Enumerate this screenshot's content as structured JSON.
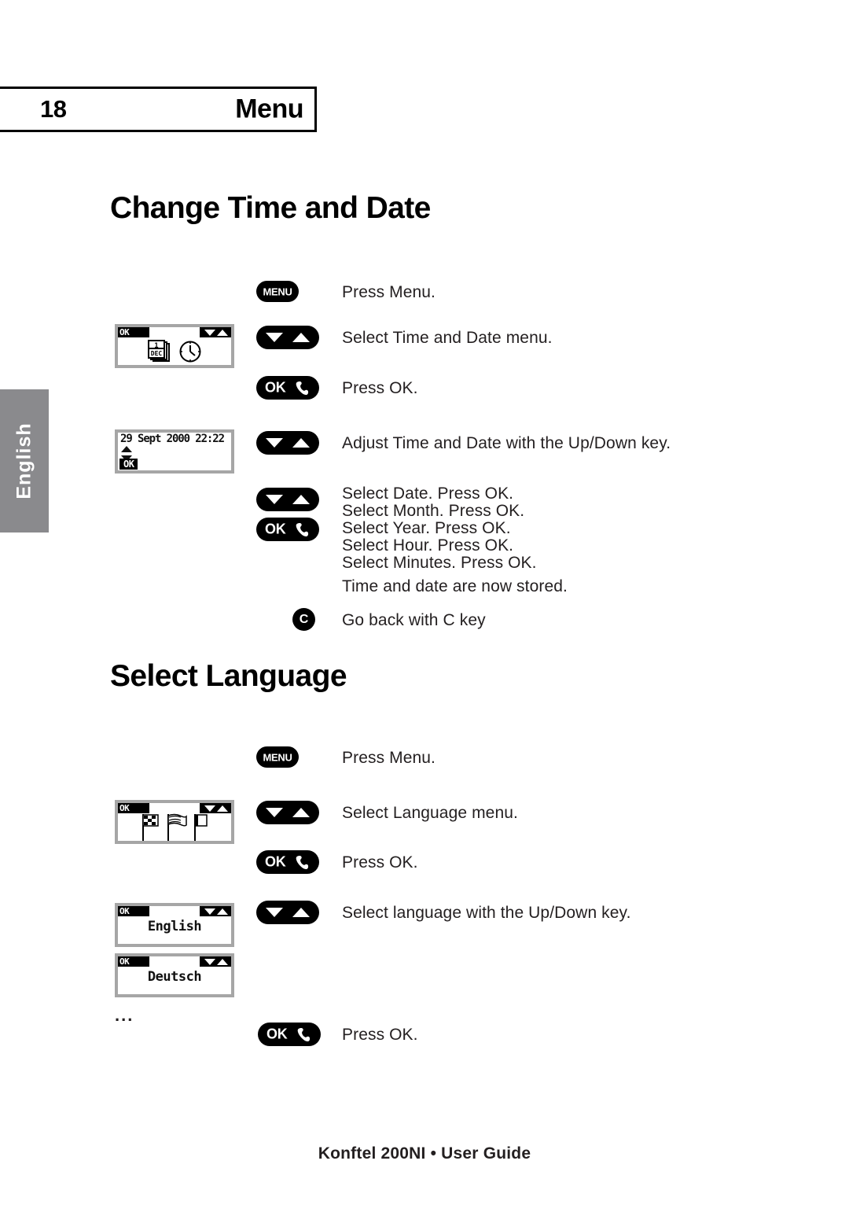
{
  "header": {
    "page_number": "18",
    "title": "Menu"
  },
  "side_tab": {
    "label": "English"
  },
  "sections": [
    {
      "heading": "Change Time and Date",
      "steps": [
        {
          "key": "menu-key",
          "key_label": "MENU",
          "text": "Press Menu."
        },
        {
          "key": "updown-key",
          "text": "Select Time and Date menu."
        },
        {
          "key": "ok-key",
          "key_label": "OK",
          "text": "Press OK."
        },
        {
          "key": "updown-key",
          "text": "Adjust Time and Date with the Up/Down key."
        },
        {
          "key": "updown-ok-key",
          "key_label": "OK",
          "text": "Select Date. Press OK.\nSelect Month. Press OK.\nSelect Year. Press OK.\nSelect Hour. Press OK.\nSelect Minutes. Press OK."
        },
        {
          "key": "none",
          "text": "Time and date are now stored."
        },
        {
          "key": "c-key",
          "key_label": "C",
          "text": "Go back with C key"
        }
      ]
    },
    {
      "heading": "Select Language",
      "steps": [
        {
          "key": "menu-key",
          "key_label": "MENU",
          "text": "Press Menu."
        },
        {
          "key": "updown-key",
          "text": "Select Language menu."
        },
        {
          "key": "ok-key",
          "key_label": "OK",
          "text": "Press OK."
        },
        {
          "key": "updown-key",
          "text": "Select language with the Up/Down key."
        },
        {
          "key": "ok-key",
          "key_label": "OK",
          "text": "Press OK."
        }
      ]
    }
  ],
  "displays": {
    "time_date_menu": {
      "status_ok": "OK",
      "icons": "calendar-clock-icons",
      "calendar_day": "1",
      "calendar_month": "DEC"
    },
    "time_date_edit": {
      "value": "29 Sept 2000 22:22",
      "status_ok": "OK"
    },
    "language_menu": {
      "status_ok": "OK",
      "icons": "flags-icons"
    },
    "language_english": {
      "status_ok": "OK",
      "value": "English"
    },
    "language_deutsch": {
      "status_ok": "OK",
      "value": "Deutsch"
    }
  },
  "more_indicator": "...",
  "footer": {
    "text": "Konftel 200NI • User Guide"
  },
  "colors": {
    "tab_grey": "#8a8a8d",
    "lcd_frame": "#a6a6a6",
    "text": "#231f20"
  }
}
